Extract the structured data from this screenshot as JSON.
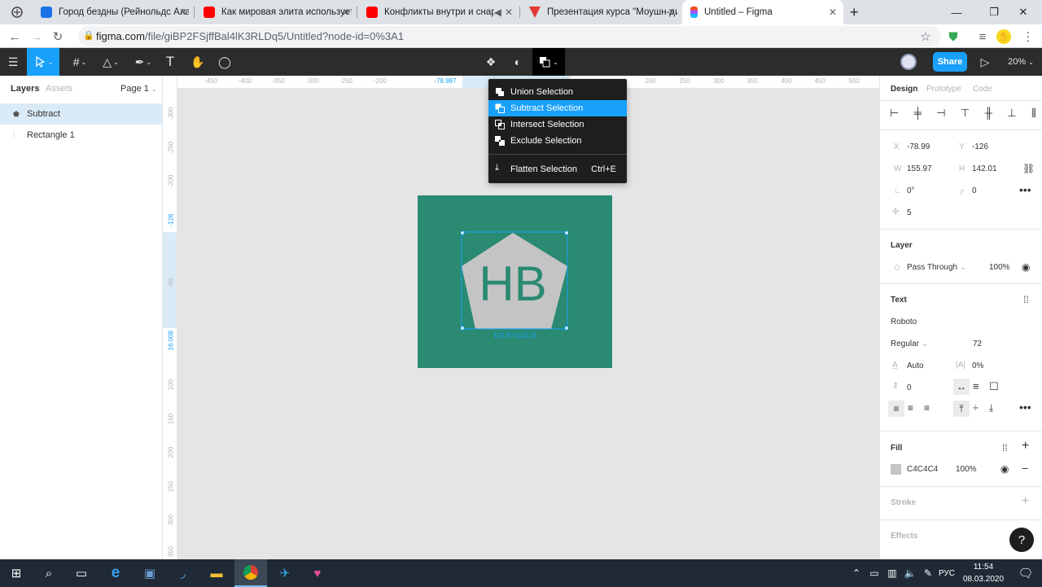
{
  "browser": {
    "tabs": [
      {
        "title": "Город бездны (Рейнольдс Алас",
        "color": "#1a73e8"
      },
      {
        "title": "Как мировая элита использует т",
        "color": "#ff0000"
      },
      {
        "title": "Конфликты внутри и снаружи",
        "color": "#ff0000"
      },
      {
        "title": "Презентация курса \"Моушн-ди",
        "color": "#e53935"
      },
      {
        "title": "Untitled – Figma",
        "color": "#f24e1e"
      }
    ],
    "new_tab": "+",
    "url_host": "figma.com",
    "url_path": "/file/giBP2FSjffBal4lK3RLDq5/Untitled?node-id=0%3A1"
  },
  "toolbar": {
    "share_label": "Share",
    "zoom": "20%"
  },
  "left_panel": {
    "tabs": {
      "layers": "Layers",
      "assets": "Assets"
    },
    "page": "Page 1",
    "layers": [
      {
        "name": "Subtract",
        "selected": true
      },
      {
        "name": "Rectangle 1",
        "selected": false
      }
    ]
  },
  "rulers": {
    "h": [
      "-450",
      "-400",
      "-350",
      "-300",
      "-250",
      "-200",
      "-78.987",
      "200",
      "250",
      "300",
      "350",
      "400",
      "450",
      "500"
    ],
    "v": [
      "-300",
      "-250",
      "-200",
      "-126",
      "-50",
      "16.008",
      "100",
      "150",
      "200",
      "250",
      "300",
      "350"
    ]
  },
  "canvas": {
    "logo_text": "HB",
    "selection_size": "155.97×142.01",
    "frame_color": "#2a8a72",
    "shape_color": "#C4C4C4",
    "text_color": "#2a8a72"
  },
  "bool_menu": {
    "items": [
      {
        "label": "Union Selection",
        "selected": false
      },
      {
        "label": "Subtract Selection",
        "selected": true
      },
      {
        "label": "Intersect Selection",
        "selected": false
      },
      {
        "label": "Exclude Selection",
        "selected": false
      }
    ],
    "flatten": {
      "label": "Flatten Selection",
      "shortcut": "Ctrl+E"
    }
  },
  "right_panel": {
    "tabs": {
      "design": "Design",
      "prototype": "Prototype",
      "code": "Code"
    },
    "x_label": "X",
    "x": "-78.99",
    "y_label": "Y",
    "y": "-126",
    "w_label": "W",
    "w": "155.97",
    "h_label": "H",
    "h": "142.01",
    "rotation": "0°",
    "radius": "0",
    "points": "5",
    "layer_title": "Layer",
    "blend": "Pass Through",
    "opacity": "100%",
    "text_title": "Text",
    "font": "Roboto",
    "weight": "Regular",
    "font_size": "72",
    "line_height": "Auto",
    "letter_spacing": "0%",
    "paragraph": "0",
    "fill_title": "Fill",
    "fill_hex": "C4C4C4",
    "fill_opacity": "100%",
    "stroke_title": "Stroke",
    "effects_title": "Effects"
  },
  "taskbar": {
    "lang": "РУС",
    "time": "11:54",
    "date": "08.03.2020"
  },
  "help": "?"
}
